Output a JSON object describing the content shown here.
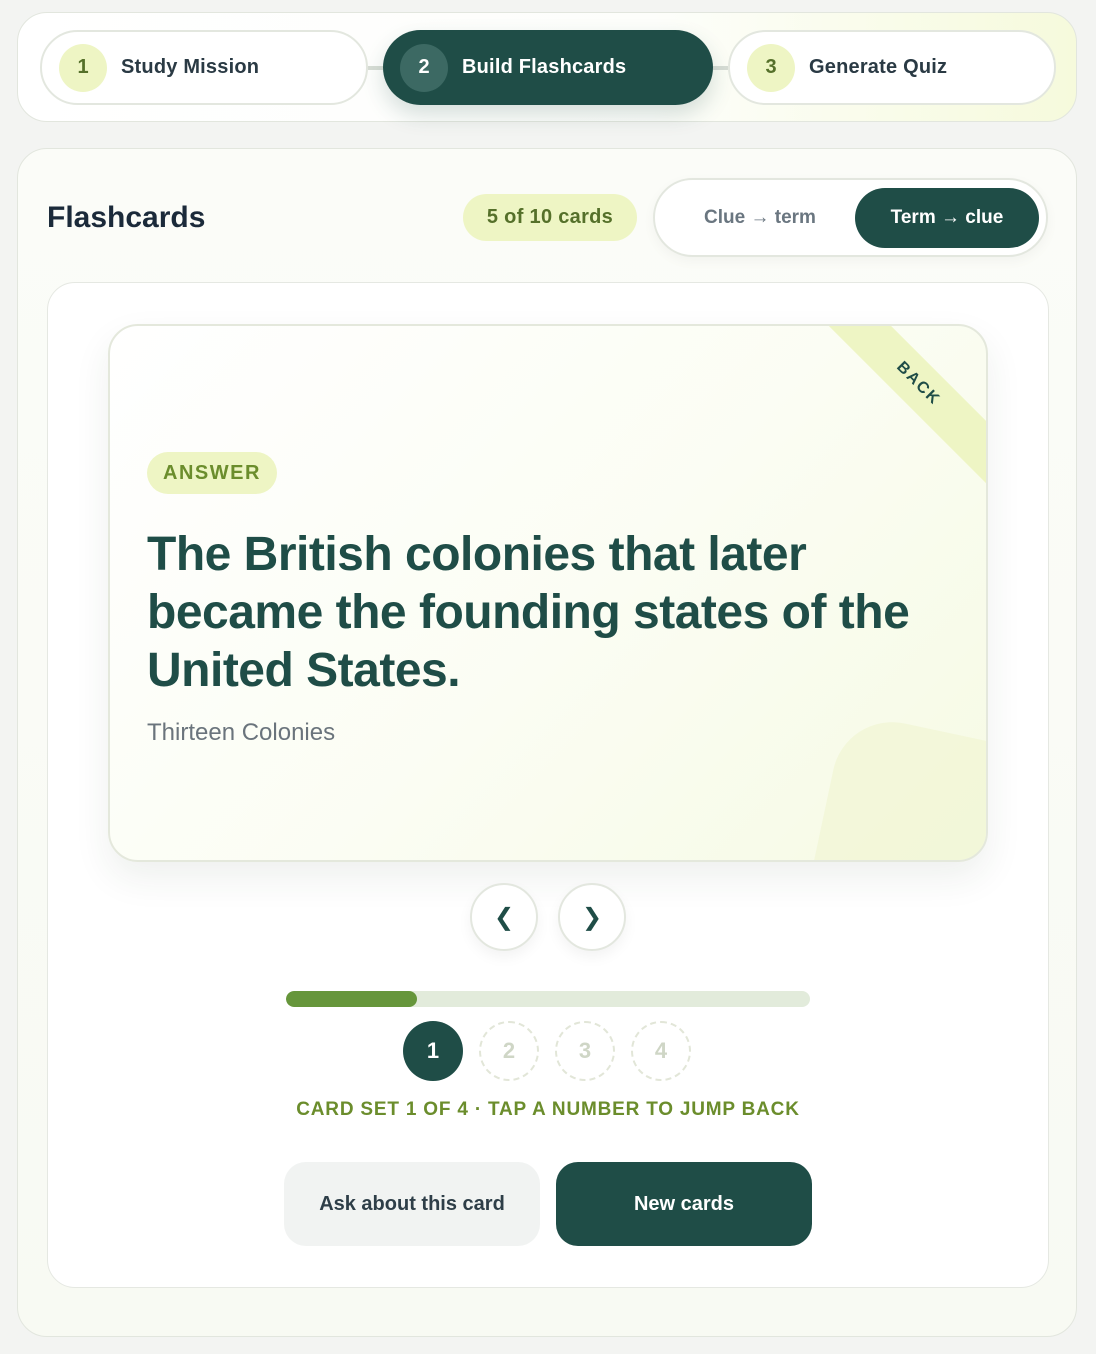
{
  "stepper": {
    "steps": [
      {
        "number": "1",
        "label": "Study Mission"
      },
      {
        "number": "2",
        "label": "Build Flashcards"
      },
      {
        "number": "3",
        "label": "Generate Quiz"
      }
    ],
    "active_step": 2
  },
  "flashcards": {
    "title": "Flashcards",
    "count_badge": "5 of 10 cards",
    "mode_toggle": {
      "options": [
        "Clue → term",
        "Term → clue"
      ],
      "selected": "Term → clue"
    },
    "card": {
      "side_ribbon": "BACK",
      "tag": "ANSWER",
      "answer": "The British colonies that later became the founding states of the United States.",
      "term": "Thirteen Colonies"
    },
    "nav": {
      "prev_icon": "❮",
      "next_icon": "❯"
    },
    "progress_fraction": 0.25,
    "card_sets": {
      "items": [
        "1",
        "2",
        "3",
        "4"
      ],
      "active": "1",
      "caption": "CARD SET 1 OF 4 · TAP A NUMBER TO JUMP BACK"
    },
    "actions": {
      "ask_label": "Ask about this card",
      "new_label": "New cards"
    }
  },
  "colors": {
    "primary": "#1f4d47",
    "accent_light": "#eef5c4",
    "accent_text": "#6b8d2c",
    "progress_fill": "#66963b"
  }
}
